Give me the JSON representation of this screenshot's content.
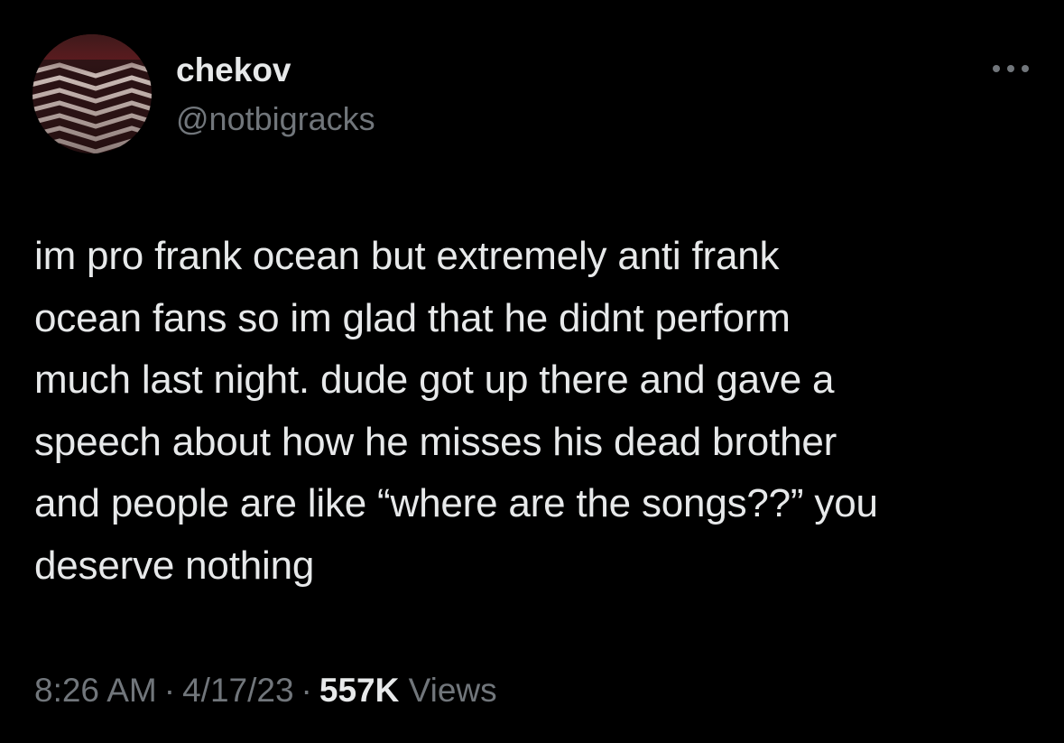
{
  "user": {
    "display_name": "chekov",
    "handle": "@notbigracks",
    "avatar_icon": "avatar-zigzag-floor"
  },
  "menu": {
    "icon": "more-horizontal-icon"
  },
  "tweet": {
    "text": "im pro frank ocean but extremely anti frank\nocean fans so im glad that he didnt perform\nmuch last night. dude got up there and gave a\nspeech about how he misses his dead brother\nand people are like “where are the songs??” you\ndeserve nothing"
  },
  "meta": {
    "time": "8:26 AM",
    "separator": "·",
    "date": "4/17/23",
    "views_count": "557K",
    "views_label": "Views"
  },
  "colors": {
    "background": "#000000",
    "primary_text": "#e7e9ea",
    "secondary_text": "#71767b"
  }
}
